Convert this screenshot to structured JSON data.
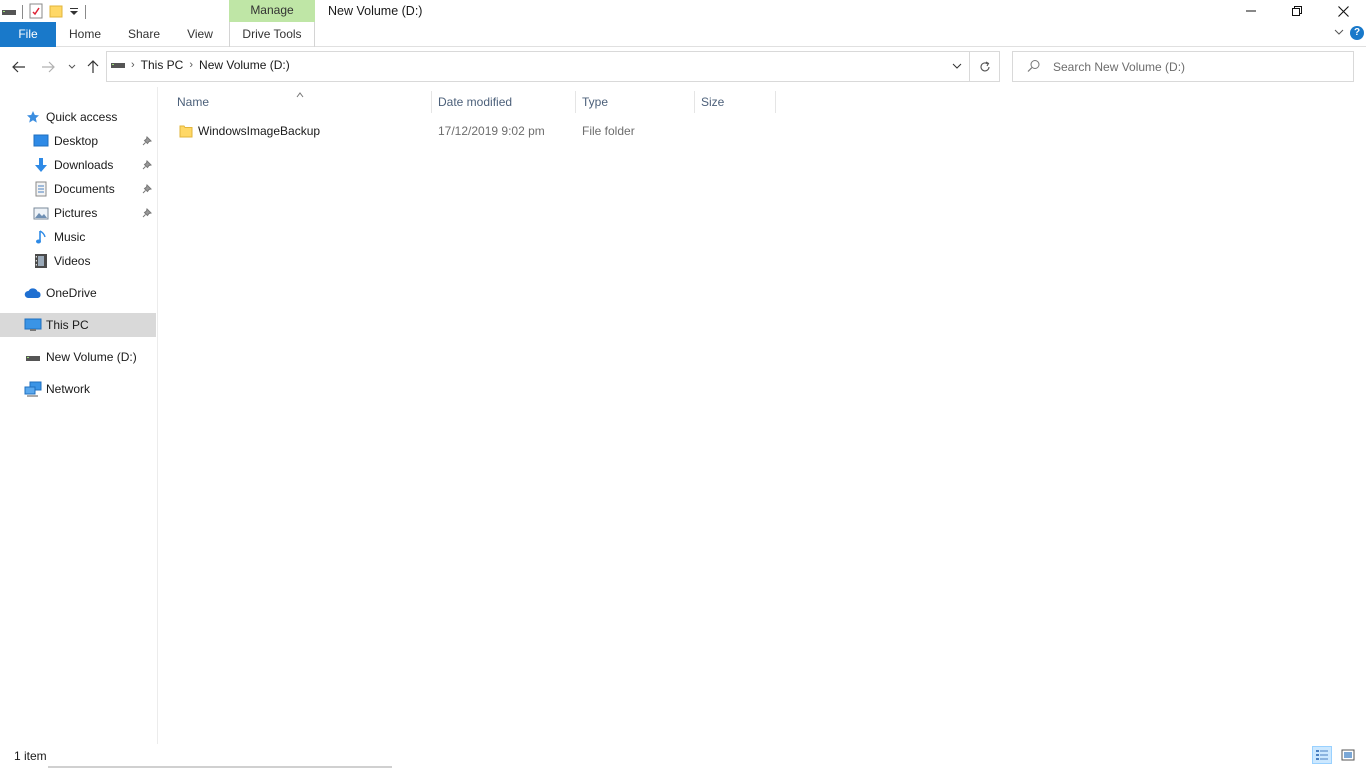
{
  "titlebar": {
    "contextual_tab": "Manage",
    "window_title": "New Volume (D:)"
  },
  "ribbon": {
    "tabs": [
      "File",
      "Home",
      "Share",
      "View",
      "Drive Tools"
    ]
  },
  "address": {
    "path": [
      "This PC",
      "New Volume (D:)"
    ]
  },
  "search": {
    "placeholder": "Search New Volume (D:)"
  },
  "navpane": {
    "items": [
      {
        "label": "Quick access",
        "icon": "star-icon"
      },
      {
        "label": "Desktop",
        "icon": "desktop-icon",
        "pinned": true
      },
      {
        "label": "Downloads",
        "icon": "download-icon",
        "pinned": true
      },
      {
        "label": "Documents",
        "icon": "document-icon",
        "pinned": true
      },
      {
        "label": "Pictures",
        "icon": "picture-icon",
        "pinned": true
      },
      {
        "label": "Music",
        "icon": "music-icon"
      },
      {
        "label": "Videos",
        "icon": "video-icon"
      },
      {
        "label": "OneDrive",
        "icon": "cloud-icon"
      },
      {
        "label": "This PC",
        "icon": "computer-icon",
        "selected": true
      },
      {
        "label": "New Volume (D:)",
        "icon": "drive-icon"
      },
      {
        "label": "Network",
        "icon": "network-icon"
      }
    ]
  },
  "columns": [
    "Name",
    "Date modified",
    "Type",
    "Size"
  ],
  "files": [
    {
      "name": "WindowsImageBackup",
      "date_modified": "17/12/2019 9:02 pm",
      "type": "File folder",
      "size": ""
    }
  ],
  "status": {
    "item_count": "1 item"
  },
  "colors": {
    "accent": "#1979ca",
    "manage_tab": "#bfe6a6",
    "selected_nav": "#d9d9d9",
    "column_header_text": "#4c607a"
  }
}
